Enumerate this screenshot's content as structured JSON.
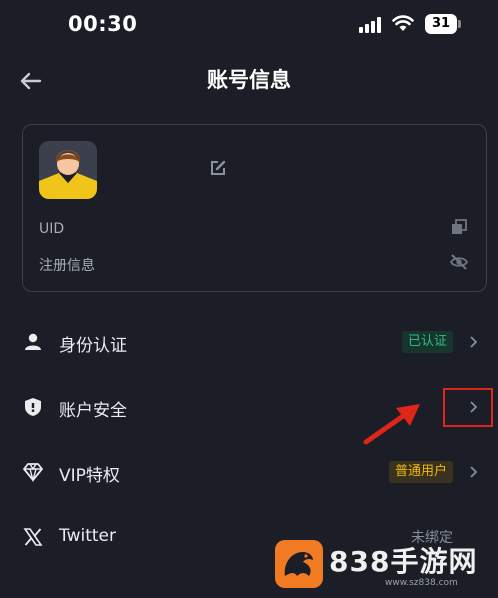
{
  "status_bar": {
    "time": "00:30",
    "battery": "31"
  },
  "header": {
    "title": "账号信息",
    "back_icon": "arrow-left-icon"
  },
  "profile": {
    "uid_label": "UID",
    "registration_label": "注册信息",
    "icons": [
      "edit-icon",
      "copy-icon",
      "eye-off-icon"
    ]
  },
  "menu": [
    {
      "id": "identity",
      "icon": "user-icon",
      "label": "身份认证",
      "status": "已认证",
      "status_color": "#2ebd85"
    },
    {
      "id": "security",
      "icon": "shield-icon",
      "label": "账户安全",
      "status": ""
    },
    {
      "id": "vip",
      "icon": "diamond-icon",
      "label": "VIP特权",
      "status": "普通用户",
      "status_color": "#f0b90b"
    },
    {
      "id": "twitter",
      "icon": "x-logo-icon",
      "label": "Twitter",
      "status": "未绑定"
    }
  ],
  "watermark": {
    "text": "838手游网",
    "url": "www.sz838.com"
  },
  "colors": {
    "background": "#1b1e26",
    "accent_green": "#2ebd85",
    "accent_yellow": "#f0b90b",
    "annotation_red": "#e0261b"
  }
}
